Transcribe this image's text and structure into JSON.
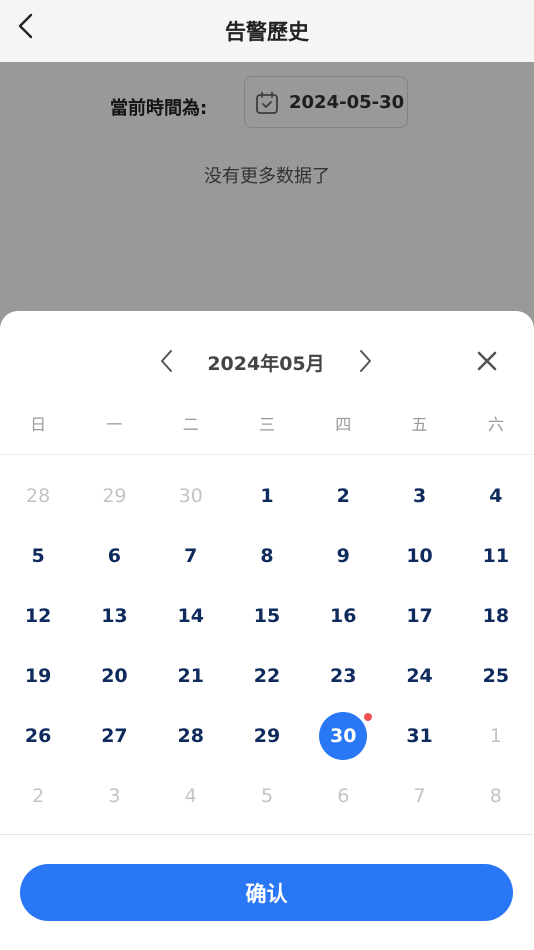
{
  "header": {
    "title": "告警歷史",
    "back_icon": "chevron-left-icon"
  },
  "filter": {
    "label": "當前時間為:",
    "date": "2024-05-30",
    "calendar_icon": "calendar-icon"
  },
  "list": {
    "empty_text": "没有更多数据了"
  },
  "calendar": {
    "month_title": "2024年05月",
    "prev_icon": "chevron-left-icon",
    "next_icon": "chevron-right-icon",
    "close_icon": "close-icon",
    "weekdays": [
      "日",
      "一",
      "二",
      "三",
      "四",
      "五",
      "六"
    ],
    "selected_day": "30",
    "accent_color": "#2a77f5",
    "marker_color": "#f05252",
    "weeks": [
      [
        {
          "d": "28",
          "m": true
        },
        {
          "d": "29",
          "m": true
        },
        {
          "d": "30",
          "m": true
        },
        {
          "d": "1"
        },
        {
          "d": "2"
        },
        {
          "d": "3"
        },
        {
          "d": "4"
        }
      ],
      [
        {
          "d": "5"
        },
        {
          "d": "6"
        },
        {
          "d": "7"
        },
        {
          "d": "8"
        },
        {
          "d": "9"
        },
        {
          "d": "10"
        },
        {
          "d": "11"
        }
      ],
      [
        {
          "d": "12"
        },
        {
          "d": "13"
        },
        {
          "d": "14"
        },
        {
          "d": "15"
        },
        {
          "d": "16"
        },
        {
          "d": "17"
        },
        {
          "d": "18"
        }
      ],
      [
        {
          "d": "19"
        },
        {
          "d": "20"
        },
        {
          "d": "21"
        },
        {
          "d": "22"
        },
        {
          "d": "23"
        },
        {
          "d": "24"
        },
        {
          "d": "25"
        }
      ],
      [
        {
          "d": "26"
        },
        {
          "d": "27"
        },
        {
          "d": "28"
        },
        {
          "d": "29"
        },
        {
          "d": "30",
          "s": true,
          "dot": true
        },
        {
          "d": "31"
        },
        {
          "d": "1",
          "m": true
        }
      ],
      [
        {
          "d": "2",
          "m": true
        },
        {
          "d": "3",
          "m": true
        },
        {
          "d": "4",
          "m": true
        },
        {
          "d": "5",
          "m": true
        },
        {
          "d": "6",
          "m": true
        },
        {
          "d": "7",
          "m": true
        },
        {
          "d": "8",
          "m": true
        }
      ]
    ]
  },
  "confirm_label": "确认"
}
